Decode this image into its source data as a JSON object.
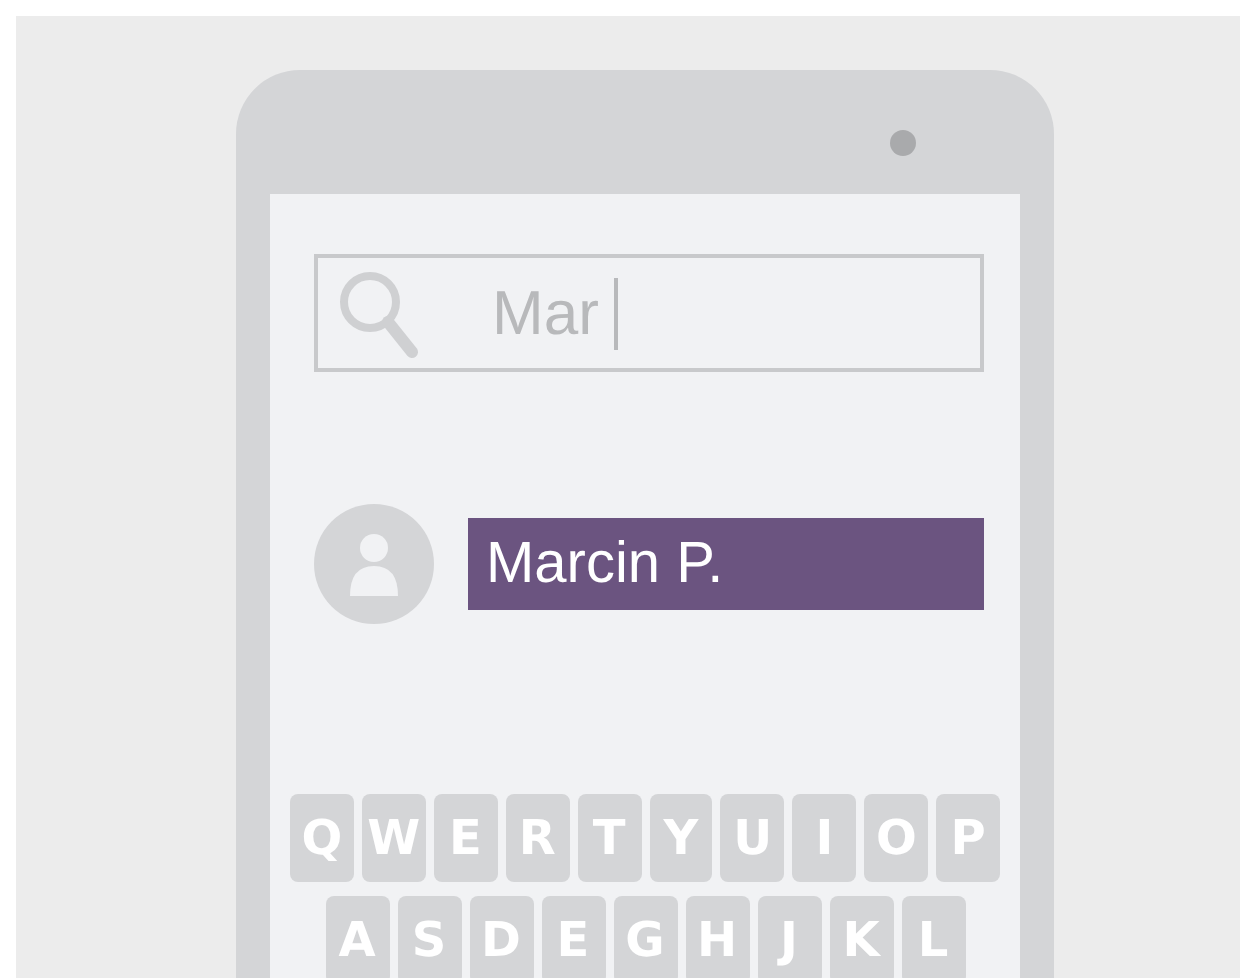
{
  "search": {
    "value": "Mar"
  },
  "results": [
    {
      "name": "Marcin P.",
      "selected": true
    }
  ],
  "keyboard": {
    "rows": [
      [
        "Q",
        "W",
        "E",
        "R",
        "T",
        "Y",
        "U",
        "I",
        "O",
        "P"
      ],
      [
        "A",
        "S",
        "D",
        "E",
        "G",
        "H",
        "J",
        "K",
        "L"
      ]
    ]
  }
}
